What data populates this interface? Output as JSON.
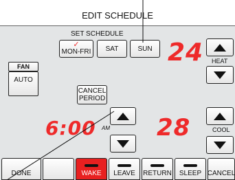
{
  "header": {
    "title": "EDIT SCHEDULE"
  },
  "set_schedule": {
    "label": "SET SCHEDULE",
    "days": [
      {
        "label": "MON-FRI",
        "checked": true,
        "check_mark": "✓"
      },
      {
        "label": "SAT",
        "checked": false
      },
      {
        "label": "SUN",
        "checked": false
      }
    ]
  },
  "fan": {
    "label": "FAN",
    "mode": "AUTO"
  },
  "cancel_period": {
    "line1": "CANCEL",
    "line2": "PERIOD"
  },
  "time": {
    "value": "6:00",
    "meridiem": "AM"
  },
  "heat": {
    "setpoint": "24",
    "label": "HEAT"
  },
  "cool": {
    "setpoint": "28",
    "label": "COOL"
  },
  "periods": [
    {
      "label": "DONE",
      "active": false,
      "show_bar": false
    },
    {
      "label": "",
      "active": false,
      "show_bar": false
    },
    {
      "label": "WAKE",
      "active": true,
      "show_bar": true
    },
    {
      "label": "LEAVE",
      "active": false,
      "show_bar": true
    },
    {
      "label": "RETURN",
      "active": false,
      "show_bar": true
    },
    {
      "label": "SLEEP",
      "active": false,
      "show_bar": true
    },
    {
      "label": "CANCEL",
      "active": false,
      "show_bar": false
    }
  ],
  "colors": {
    "lcd_red": "#ee2a2a",
    "active_tab": "#e82020",
    "lcd_bg": "#e3e5e6"
  }
}
